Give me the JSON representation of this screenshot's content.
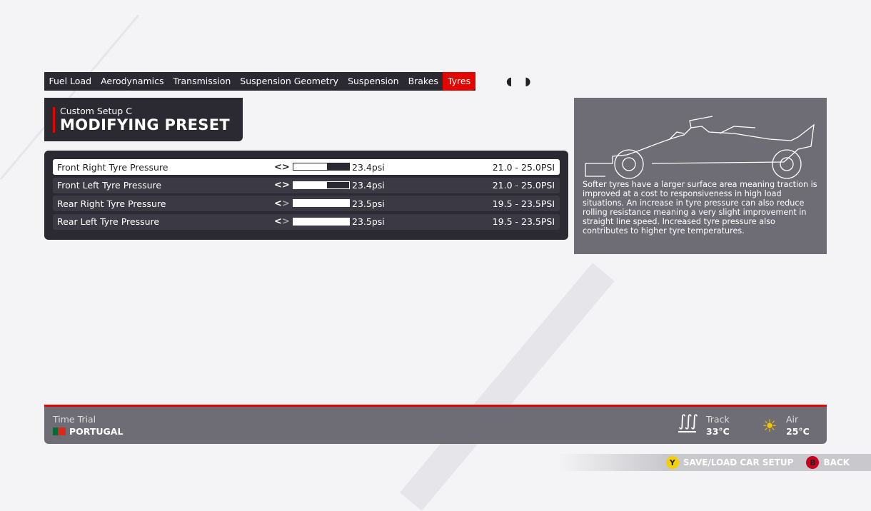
{
  "tabs": [
    {
      "label": "Fuel Load"
    },
    {
      "label": "Aerodynamics"
    },
    {
      "label": "Transmission"
    },
    {
      "label": "Suspension Geometry"
    },
    {
      "label": "Suspension"
    },
    {
      "label": "Brakes"
    },
    {
      "label": "Tyres",
      "active": true
    }
  ],
  "header": {
    "subtitle": "Custom Setup  C",
    "title": "MODIFYING PRESET"
  },
  "rows": [
    {
      "label": "Front Right Tyre Pressure",
      "value": "23.4psi",
      "range": "21.0 - 25.0PSI",
      "fill_percent": 60,
      "selected": true
    },
    {
      "label": "Front Left Tyre Pressure",
      "value": "23.4psi",
      "range": "21.0 - 25.0PSI",
      "fill_percent": 60
    },
    {
      "label": "Rear Right Tyre Pressure",
      "value": "23.5psi",
      "range": "19.5 - 23.5PSI",
      "fill_percent": 100
    },
    {
      "label": "Rear Left Tyre Pressure",
      "value": "23.5psi",
      "range": "19.5 - 23.5PSI",
      "fill_percent": 100
    }
  ],
  "info": {
    "text": "Softer tyres have a larger surface area meaning traction is improved at a cost to responsiveness in high load situations. An increase in tyre pressure can also reduce rolling resistance meaning a very slight improvement in straight line speed. Increased tyre pressure also contributes to higher tyre temperatures."
  },
  "footer": {
    "mode": "Time Trial",
    "track": "PORTUGAL",
    "track_temp_label": "Track",
    "track_temp": "33°C",
    "air_label": "Air",
    "air_temp": "25°C"
  },
  "buttons": {
    "y_key": "Y",
    "save_load": "SAVE/LOAD CAR SETUP",
    "b_key": "B",
    "back": "BACK"
  },
  "colors": {
    "accent": "#e10600",
    "panel": "#2b2a33",
    "info": "#6e6d75"
  }
}
